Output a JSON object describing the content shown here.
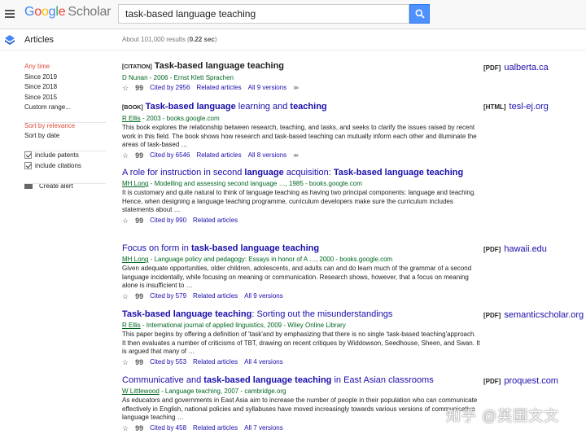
{
  "header": {
    "logo_google": [
      "G",
      "o",
      "o",
      "g",
      "l",
      "e"
    ],
    "logo_scholar": "Scholar",
    "search_query": "task-based language teaching"
  },
  "subheader": {
    "section": "Articles",
    "count_prefix": "About 101,000 results (",
    "count_time": "0.22 sec",
    "count_suffix": ")"
  },
  "sidebar": {
    "time_filters": [
      "Any time",
      "Since 2019",
      "Since 2018",
      "Since 2015",
      "Custom range..."
    ],
    "sort": [
      "Sort by relevance",
      "Sort by date"
    ],
    "include_patents": "include patents",
    "include_citations": "include citations",
    "create_alert": "Create alert"
  },
  "results": [
    {
      "tag": "[CITATION]",
      "title_parts": [
        "Task-based language teaching"
      ],
      "meta": "D Nunan - 2006 - Ernst Klett Sprachen",
      "snippet": "",
      "cited": "Cited by 2956",
      "related": "Related articles",
      "versions": "All 9 versions",
      "side_fmt": "[PDF]",
      "side_src": "ualberta.ca"
    },
    {
      "tag": "[BOOK]",
      "title_parts": [
        "Task-based language",
        " learning and ",
        "teaching"
      ],
      "meta_author": "R Ellis",
      "meta_rest": " - 2003 - books.google.com",
      "snippet": "This book explores the relationship between research, teaching, and tasks, and seeks to clarify the issues raised by recent work in this field. The book shows how research and task-based teaching can mutually inform each other and illuminate the areas of task-based …",
      "cited": "Cited by 6546",
      "related": "Related articles",
      "versions": "All 8 versions",
      "side_fmt": "[HTML]",
      "side_src": "tesl-ej.org"
    },
    {
      "title_parts": [
        "A role for instruction in second ",
        "language",
        " acquisition: ",
        "Task-based language teaching"
      ],
      "meta_author": "MH Long",
      "meta_rest": " - Modelling and assessing second language …, 1985 - books.google.com",
      "snippet": "It is customary and quite natural to think of language teaching as having two principal components: language and teaching. Hence, when designing a language teaching programme, curriculum developers make sure the curriculum includes statements about …",
      "cited": "Cited by 990",
      "related": "Related articles"
    },
    {
      "title_parts": [
        "Focus on form in ",
        "task-based language teaching"
      ],
      "meta_author": "MH Long",
      "meta_rest": " - Language policy and pedagogy: Essays in honor of A …, 2000 - books.google.com",
      "snippet": "Given adequate opportunities, older children, adolescents, and adults can and do learn much of the grammar of a second language incidentally, while focusing on meaning or communication. Research shows, however, that a focus on meaning alone is insufficient to …",
      "cited": "Cited by 579",
      "related": "Related articles",
      "versions": "All 9 versions",
      "side_fmt": "[PDF]",
      "side_src": "hawaii.edu"
    },
    {
      "title_parts": [
        "Task-based language teaching",
        ": Sorting out the misunderstandings"
      ],
      "meta_author": "R Ellis",
      "meta_rest": " - International journal of applied linguistics, 2009 - Wiley Online Library",
      "snippet": "This paper begins by offering a definition of 'task'and by emphasizing that there is no single 'task-based teaching'approach. It then evaluates a number of criticisms of TBT, drawing on recent critiques by Widdowson, Seedhouse, Sheen, and Swan. It is argued that many of …",
      "cited": "Cited by 553",
      "related": "Related articles",
      "versions": "All 4 versions",
      "side_fmt": "[PDF]",
      "side_src": "semanticscholar.org"
    },
    {
      "title_parts": [
        "Communicative and ",
        "task-based language teaching",
        " in East Asian classrooms"
      ],
      "meta_author": "W Littlewood",
      "meta_rest": " - Language teaching, 2007 - cambridge.org",
      "snippet": "As educators and governments in East Asia aim to increase the number of people in their population who can communicate effectively in English, national policies and syllabuses have moved increasingly towards various versions of communicative language teaching …",
      "cited": "Cited by 458",
      "related": "Related articles",
      "versions": "All 7 versions",
      "side_fmt": "[PDF]",
      "side_src": "proquest.com"
    }
  ],
  "watermark": "知乎 @英国文文"
}
